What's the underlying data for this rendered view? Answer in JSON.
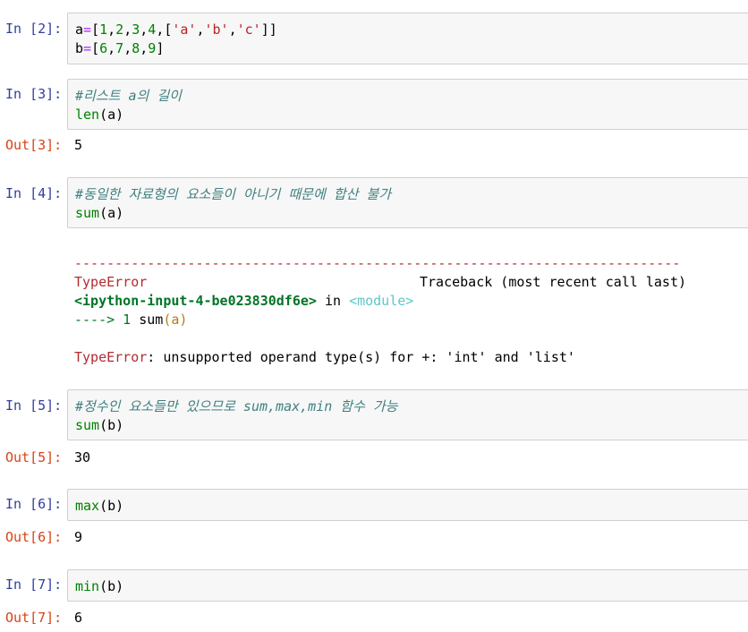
{
  "cells": [
    {
      "in_prompt": "In [2]:",
      "lines": [
        "a=[1,2,3,4,['a','b','c']]",
        "b=[6,7,8,9]"
      ]
    },
    {
      "in_prompt": "In [3]:",
      "comment": "#리스트 a의 길이",
      "func": "len",
      "arg": "(a)",
      "out_prompt": "Out[3]:",
      "output": "5"
    },
    {
      "in_prompt": "In [4]:",
      "comment": "#동일한 자료형의 요소들이 아니기 때문에 합산 불가",
      "func": "sum",
      "arg": "(a)"
    },
    {
      "in_prompt": "In [5]:",
      "comment": "#정수인 요소들만 있으므로 sum,max,min 함수 가능",
      "func": "sum",
      "arg": "(b)",
      "out_prompt": "Out[5]:",
      "output": "30"
    },
    {
      "in_prompt": "In [6]:",
      "func": "max",
      "arg": "(b)",
      "out_prompt": "Out[6]:",
      "output": "9"
    },
    {
      "in_prompt": "In [7]:",
      "func": "min",
      "arg": "(b)",
      "out_prompt": "Out[7]:",
      "output": "6"
    }
  ],
  "traceback": {
    "separator": "---------------------------------------------------------------------------",
    "error_type": "TypeError",
    "header_right": "Traceback (most recent call last)",
    "input_ref": "<ipython-input-4-be023830df6e>",
    "in_word": " in ",
    "module": "<module>",
    "arrow": "----> 1 ",
    "call_func": "sum",
    "call_arg": "(a)",
    "final_error_type": "TypeError",
    "final_message": ": unsupported operand type(s) for +: 'int' and 'list'"
  },
  "colors": {
    "in_prompt": "#303f9f",
    "out_prompt": "#d84315",
    "comment": "#408080",
    "builtin": "#008000",
    "string": "#ba2121",
    "error": "#b22b31"
  }
}
